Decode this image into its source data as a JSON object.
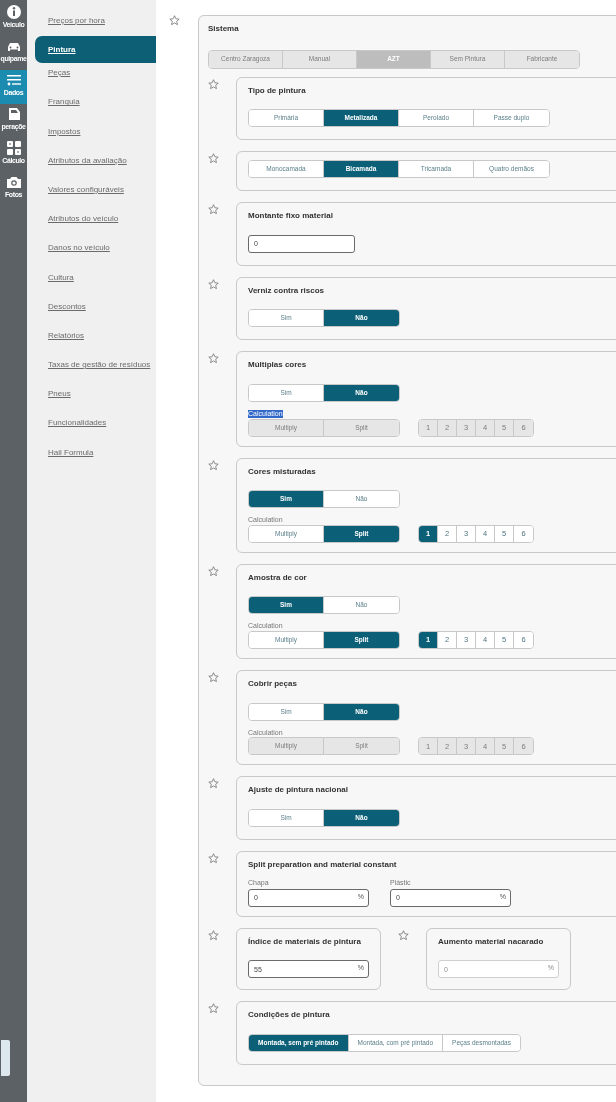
{
  "rail": [
    {
      "label": "Veículo",
      "selected": false
    },
    {
      "label": "quipame",
      "selected": false
    },
    {
      "label": "Dados",
      "selected": true
    },
    {
      "label": "peraçõe",
      "selected": false
    },
    {
      "label": "Cálculo",
      "selected": false
    },
    {
      "label": "Fotos",
      "selected": false
    }
  ],
  "subnav": [
    {
      "label": "Preços por hora",
      "selected": false
    },
    {
      "label": "Pintura",
      "selected": true
    },
    {
      "label": "Peças",
      "selected": false
    },
    {
      "label": "Franquia",
      "selected": false
    },
    {
      "label": "Impostos",
      "selected": false
    },
    {
      "label": "Atributos da avaliação",
      "selected": false
    },
    {
      "label": "Valores configuráveis",
      "selected": false
    },
    {
      "label": "Atributos do veículo",
      "selected": false
    },
    {
      "label": "Danos no veículo",
      "selected": false
    },
    {
      "label": "Cultura",
      "selected": false
    },
    {
      "label": "Descontos",
      "selected": false
    },
    {
      "label": "Relatórios",
      "selected": false
    },
    {
      "label": "Taxas de gestão de resíduos",
      "selected": false
    },
    {
      "label": "Pneus",
      "selected": false
    },
    {
      "label": "Funcionalidades",
      "selected": false
    },
    {
      "label": "Hail Formula",
      "selected": false
    }
  ],
  "system": {
    "title": "Sistema",
    "tabs_disabled": true,
    "tabs": [
      {
        "label": "Centro Zaragoza",
        "selected": false
      },
      {
        "label": "Manual",
        "selected": false
      },
      {
        "label": "AZT",
        "selected": true
      },
      {
        "label": "Sem Pintura",
        "selected": false
      },
      {
        "label": "Fabricante",
        "selected": false
      }
    ],
    "sections": [
      {
        "kind": "segmented",
        "title": "Tipo de pintura",
        "options": [
          {
            "label": "Primária",
            "selected": false
          },
          {
            "label": "Metalizada",
            "selected": true
          },
          {
            "label": "Perolado",
            "selected": false
          },
          {
            "label": "Passe duplo",
            "selected": false
          }
        ]
      },
      {
        "kind": "segmented",
        "options": [
          {
            "label": "Monocamada",
            "selected": false
          },
          {
            "label": "Bicamada",
            "selected": true
          },
          {
            "label": "Tricamada",
            "selected": false
          },
          {
            "label": "Quatro demãos",
            "selected": false
          }
        ]
      },
      {
        "kind": "input",
        "title": "Montante fixo material",
        "value": "0"
      },
      {
        "kind": "segmented",
        "title": "Verniz contra riscos",
        "options": [
          {
            "label": "Sim",
            "selected": false
          },
          {
            "label": "Não",
            "selected": true
          }
        ]
      },
      {
        "kind": "calc",
        "title": "Múltiplas cores",
        "options": [
          {
            "label": "Sim",
            "selected": false
          },
          {
            "label": "Não",
            "selected": true
          }
        ],
        "calculation": {
          "label": "Calculation",
          "highlighted": true,
          "disabled": true,
          "methods": [
            {
              "label": "Multiply",
              "selected": false
            },
            {
              "label": "Split",
              "selected": false
            }
          ],
          "counts": [
            {
              "label": "1",
              "selected": false
            },
            {
              "label": "2",
              "selected": false
            },
            {
              "label": "3",
              "selected": false
            },
            {
              "label": "4",
              "selected": false
            },
            {
              "label": "5",
              "selected": false
            },
            {
              "label": "6",
              "selected": false
            }
          ]
        }
      },
      {
        "kind": "calc",
        "title": "Cores misturadas",
        "options": [
          {
            "label": "Sim",
            "selected": true
          },
          {
            "label": "Não",
            "selected": false
          }
        ],
        "calculation": {
          "label": "Calculation",
          "highlighted": false,
          "disabled": false,
          "methods": [
            {
              "label": "Multiply",
              "selected": false
            },
            {
              "label": "Split",
              "selected": true
            }
          ],
          "counts": [
            {
              "label": "1",
              "selected": true
            },
            {
              "label": "2",
              "selected": false
            },
            {
              "label": "3",
              "selected": false
            },
            {
              "label": "4",
              "selected": false
            },
            {
              "label": "5",
              "selected": false
            },
            {
              "label": "6",
              "selected": false
            }
          ]
        }
      },
      {
        "kind": "calc",
        "title": "Amostra de cor",
        "options": [
          {
            "label": "Sim",
            "selected": true
          },
          {
            "label": "Não",
            "selected": false
          }
        ],
        "calculation": {
          "label": "Calculation",
          "highlighted": false,
          "disabled": false,
          "methods": [
            {
              "label": "Multiply",
              "selected": false
            },
            {
              "label": "Split",
              "selected": true
            }
          ],
          "counts": [
            {
              "label": "1",
              "selected": true
            },
            {
              "label": "2",
              "selected": false
            },
            {
              "label": "3",
              "selected": false
            },
            {
              "label": "4",
              "selected": false
            },
            {
              "label": "5",
              "selected": false
            },
            {
              "label": "6",
              "selected": false
            }
          ]
        }
      },
      {
        "kind": "calc",
        "title": "Cobrir peças",
        "options": [
          {
            "label": "Sim",
            "selected": false
          },
          {
            "label": "Não",
            "selected": true
          }
        ],
        "calculation": {
          "label": "Calculation",
          "highlighted": false,
          "disabled": true,
          "methods": [
            {
              "label": "Multiply",
              "selected": false
            },
            {
              "label": "Split",
              "selected": false
            }
          ],
          "counts": [
            {
              "label": "1",
              "selected": false
            },
            {
              "label": "2",
              "selected": false
            },
            {
              "label": "3",
              "selected": false
            },
            {
              "label": "4",
              "selected": false
            },
            {
              "label": "5",
              "selected": false
            },
            {
              "label": "6",
              "selected": false
            }
          ]
        }
      },
      {
        "kind": "segmented",
        "title": "Ajuste de pintura nacional",
        "options": [
          {
            "label": "Sim",
            "selected": false
          },
          {
            "label": "Não",
            "selected": true
          }
        ]
      },
      {
        "kind": "inputs",
        "title": "Split preparation and material constant",
        "fields": [
          {
            "label": "Chapa",
            "value": "0",
            "unit": "%"
          },
          {
            "label": "Plástic",
            "value": "0",
            "unit": "%"
          }
        ]
      },
      {
        "kind": "pair",
        "items": [
          {
            "title": "Índice de materiais de pintura",
            "value": "55",
            "unit": "%",
            "disabled": false
          },
          {
            "title": "Aumento material nacarado",
            "value": "0",
            "unit": "%",
            "disabled": true
          }
        ]
      },
      {
        "kind": "segmented",
        "title": "Condições de pintura",
        "options": [
          {
            "label": "Montada, sem pré pintado",
            "selected": true
          },
          {
            "label": "Montada, com pré pintado",
            "selected": false
          },
          {
            "label": "Peças desmontadas",
            "selected": false
          }
        ]
      }
    ]
  }
}
